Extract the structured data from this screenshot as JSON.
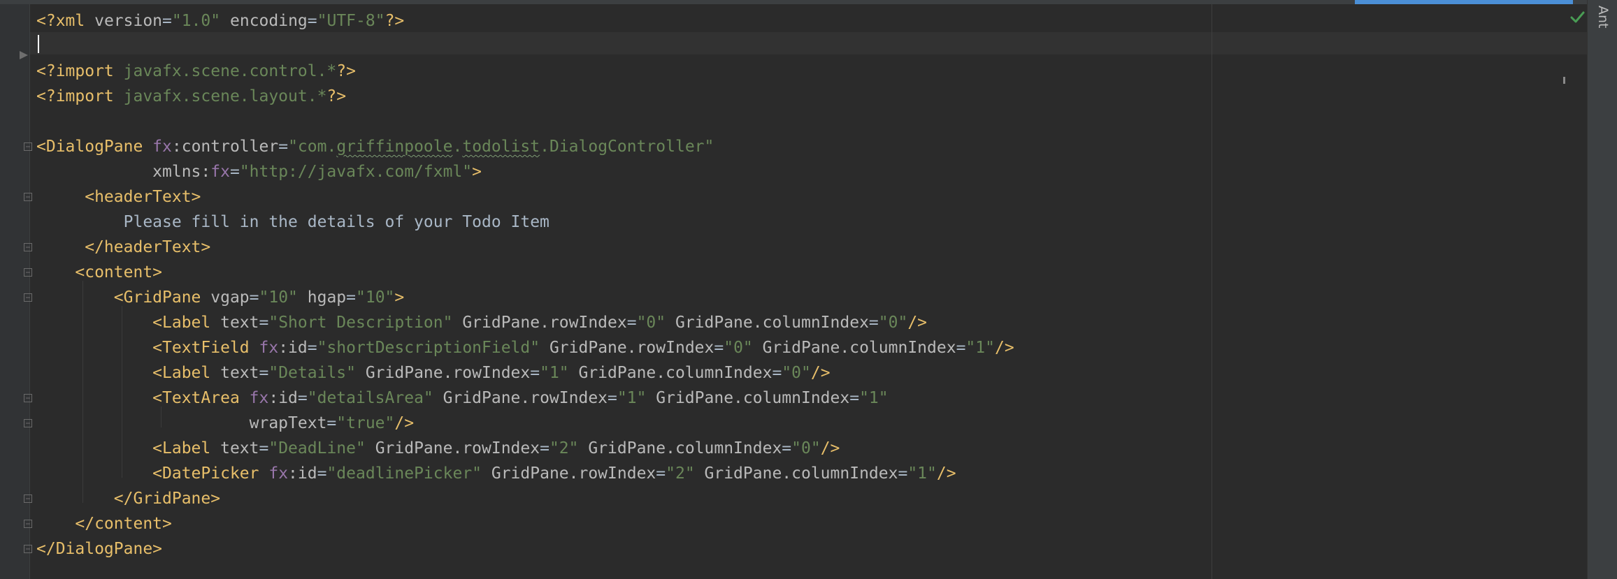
{
  "window": {
    "right_tool_tab": "Ant"
  },
  "editor": {
    "lines": [
      [
        {
          "t": "<?xml ",
          "c": "pi"
        },
        {
          "t": "version",
          "c": "attr"
        },
        {
          "t": "=",
          "c": "txt"
        },
        {
          "t": "\"1.0\"",
          "c": "str"
        },
        {
          "t": " ",
          "c": "txt"
        },
        {
          "t": "encoding",
          "c": "attr"
        },
        {
          "t": "=",
          "c": "txt"
        },
        {
          "t": "\"UTF-8\"",
          "c": "str"
        },
        {
          "t": "?>",
          "c": "pi"
        }
      ],
      [],
      [
        {
          "t": "<?import ",
          "c": "pi"
        },
        {
          "t": "javafx.scene.control.*",
          "c": "str"
        },
        {
          "t": "?>",
          "c": "pi"
        }
      ],
      [
        {
          "t": "<?import ",
          "c": "pi"
        },
        {
          "t": "javafx.scene.layout.*",
          "c": "str"
        },
        {
          "t": "?>",
          "c": "pi"
        }
      ],
      [],
      [
        {
          "t": "<DialogPane ",
          "c": "tag"
        },
        {
          "t": "fx",
          "c": "ns"
        },
        {
          "t": ":controller",
          "c": "attr"
        },
        {
          "t": "=",
          "c": "txt"
        },
        {
          "t": "\"com.",
          "c": "str"
        },
        {
          "t": "griffinpoole",
          "c": "str typo"
        },
        {
          "t": ".",
          "c": "str"
        },
        {
          "t": "todolist",
          "c": "str typo"
        },
        {
          "t": ".DialogController\"",
          "c": "str"
        }
      ],
      [
        {
          "t": "            xmlns:",
          "c": "attr"
        },
        {
          "t": "fx",
          "c": "ns"
        },
        {
          "t": "=",
          "c": "txt"
        },
        {
          "t": "\"http://javafx.com/fxml\"",
          "c": "str"
        },
        {
          "t": ">",
          "c": "tag"
        }
      ],
      [
        {
          "t": "     <headerText>",
          "c": "tag"
        }
      ],
      [
        {
          "t": "         Please fill in the details of your Todo Item",
          "c": "txt"
        }
      ],
      [
        {
          "t": "     </headerText>",
          "c": "tag"
        }
      ],
      [
        {
          "t": "    <content>",
          "c": "tag"
        }
      ],
      [
        {
          "t": "        <GridPane ",
          "c": "tag"
        },
        {
          "t": "vgap",
          "c": "attr"
        },
        {
          "t": "=",
          "c": "txt"
        },
        {
          "t": "\"10\"",
          "c": "str"
        },
        {
          "t": " ",
          "c": "txt"
        },
        {
          "t": "hgap",
          "c": "attr"
        },
        {
          "t": "=",
          "c": "txt"
        },
        {
          "t": "\"10\"",
          "c": "str"
        },
        {
          "t": ">",
          "c": "tag"
        }
      ],
      [
        {
          "t": "            <Label ",
          "c": "tag"
        },
        {
          "t": "text",
          "c": "attr"
        },
        {
          "t": "=",
          "c": "txt"
        },
        {
          "t": "\"Short Description\"",
          "c": "str"
        },
        {
          "t": " GridPane.rowIndex",
          "c": "attr"
        },
        {
          "t": "=",
          "c": "txt"
        },
        {
          "t": "\"0\"",
          "c": "str"
        },
        {
          "t": " GridPane.columnIndex",
          "c": "attr"
        },
        {
          "t": "=",
          "c": "txt"
        },
        {
          "t": "\"0\"",
          "c": "str"
        },
        {
          "t": "/>",
          "c": "tag"
        }
      ],
      [
        {
          "t": "            <TextField ",
          "c": "tag"
        },
        {
          "t": "fx",
          "c": "ns"
        },
        {
          "t": ":id",
          "c": "attr"
        },
        {
          "t": "=",
          "c": "txt"
        },
        {
          "t": "\"shortDescriptionField\"",
          "c": "str"
        },
        {
          "t": " GridPane.rowIndex",
          "c": "attr"
        },
        {
          "t": "=",
          "c": "txt"
        },
        {
          "t": "\"0\"",
          "c": "str"
        },
        {
          "t": " GridPane.columnIndex",
          "c": "attr"
        },
        {
          "t": "=",
          "c": "txt"
        },
        {
          "t": "\"1\"",
          "c": "str"
        },
        {
          "t": "/>",
          "c": "tag"
        }
      ],
      [
        {
          "t": "            <Label ",
          "c": "tag"
        },
        {
          "t": "text",
          "c": "attr"
        },
        {
          "t": "=",
          "c": "txt"
        },
        {
          "t": "\"Details\"",
          "c": "str"
        },
        {
          "t": " GridPane.rowIndex",
          "c": "attr"
        },
        {
          "t": "=",
          "c": "txt"
        },
        {
          "t": "\"1\"",
          "c": "str"
        },
        {
          "t": " GridPane.columnIndex",
          "c": "attr"
        },
        {
          "t": "=",
          "c": "txt"
        },
        {
          "t": "\"0\"",
          "c": "str"
        },
        {
          "t": "/>",
          "c": "tag"
        }
      ],
      [
        {
          "t": "            <TextArea ",
          "c": "tag"
        },
        {
          "t": "fx",
          "c": "ns"
        },
        {
          "t": ":id",
          "c": "attr"
        },
        {
          "t": "=",
          "c": "txt"
        },
        {
          "t": "\"detailsArea\"",
          "c": "str"
        },
        {
          "t": " GridPane.rowIndex",
          "c": "attr"
        },
        {
          "t": "=",
          "c": "txt"
        },
        {
          "t": "\"1\"",
          "c": "str"
        },
        {
          "t": " GridPane.columnIndex",
          "c": "attr"
        },
        {
          "t": "=",
          "c": "txt"
        },
        {
          "t": "\"1\"",
          "c": "str"
        }
      ],
      [
        {
          "t": "                      wrapText",
          "c": "attr"
        },
        {
          "t": "=",
          "c": "txt"
        },
        {
          "t": "\"true\"",
          "c": "str"
        },
        {
          "t": "/>",
          "c": "tag"
        }
      ],
      [
        {
          "t": "            <Label ",
          "c": "tag"
        },
        {
          "t": "text",
          "c": "attr"
        },
        {
          "t": "=",
          "c": "txt"
        },
        {
          "t": "\"DeadLine\"",
          "c": "str"
        },
        {
          "t": " GridPane.rowIndex",
          "c": "attr"
        },
        {
          "t": "=",
          "c": "txt"
        },
        {
          "t": "\"2\"",
          "c": "str"
        },
        {
          "t": " GridPane.columnIndex",
          "c": "attr"
        },
        {
          "t": "=",
          "c": "txt"
        },
        {
          "t": "\"0\"",
          "c": "str"
        },
        {
          "t": "/>",
          "c": "tag"
        }
      ],
      [
        {
          "t": "            <DatePicker ",
          "c": "tag"
        },
        {
          "t": "fx",
          "c": "ns"
        },
        {
          "t": ":id",
          "c": "attr"
        },
        {
          "t": "=",
          "c": "txt"
        },
        {
          "t": "\"deadlinePicker\"",
          "c": "str"
        },
        {
          "t": " GridPane.rowIndex",
          "c": "attr"
        },
        {
          "t": "=",
          "c": "txt"
        },
        {
          "t": "\"2\"",
          "c": "str"
        },
        {
          "t": " GridPane.columnIndex",
          "c": "attr"
        },
        {
          "t": "=",
          "c": "txt"
        },
        {
          "t": "\"1\"",
          "c": "str"
        },
        {
          "t": "/>",
          "c": "tag"
        }
      ],
      [
        {
          "t": "        </GridPane>",
          "c": "tag"
        }
      ],
      [
        {
          "t": "    </content>",
          "c": "tag"
        }
      ],
      [
        {
          "t": "</DialogPane>",
          "c": "tag"
        }
      ]
    ]
  },
  "colors": {
    "background": "#2b2b2b",
    "tag": "#e8bf6a",
    "attribute": "#bababa",
    "namespace": "#9876aa",
    "string": "#6a8759",
    "text": "#a9b7c6",
    "accent": "#4b8fd6",
    "inspection_ok": "#499c54"
  },
  "icons": {
    "inspection_status": "check-icon",
    "fold_markers": "fold-marker-icon"
  }
}
